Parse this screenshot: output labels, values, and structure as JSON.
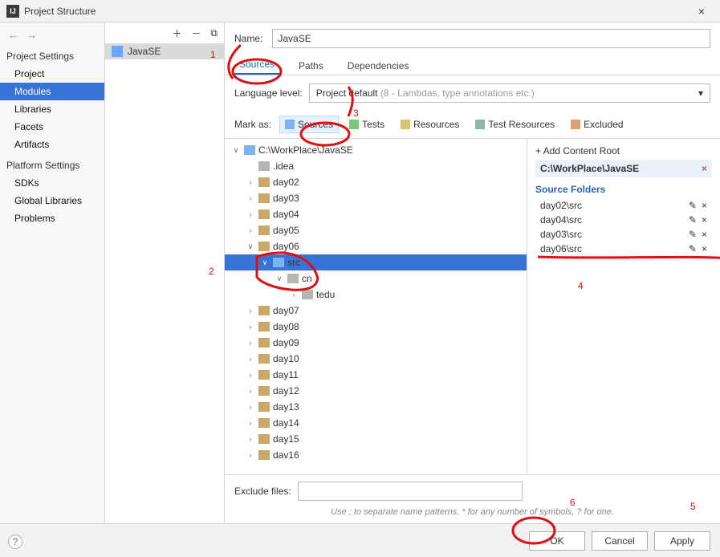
{
  "window": {
    "title": "Project Structure",
    "close": "×",
    "ok": "OK",
    "cancel": "Cancel",
    "apply": "Apply"
  },
  "nav": {
    "sections": [
      {
        "header": "Project Settings",
        "items": [
          "Project",
          "Modules",
          "Libraries",
          "Facets",
          "Artifacts"
        ],
        "selected": 1
      },
      {
        "header": "Platform Settings",
        "items": [
          "SDKs",
          "Global Libraries"
        ]
      },
      {
        "header": "",
        "items": [
          "Problems"
        ]
      }
    ]
  },
  "module": {
    "listItem": "JavaSE",
    "nameLabel": "Name:",
    "name": "JavaSE",
    "tabs": [
      "Sources",
      "Paths",
      "Dependencies"
    ],
    "activeTab": 0,
    "langLabel": "Language level:",
    "langValue": "Project default",
    "langHint": "(8 - Lambdas, type annotations etc.)",
    "markLabel": "Mark as:",
    "markButtons": [
      {
        "label": "Sources",
        "klass": "blue",
        "active": true
      },
      {
        "label": "Tests",
        "klass": "green"
      },
      {
        "label": "Resources",
        "klass": "yellow"
      },
      {
        "label": "Test Resources",
        "klass": "teal"
      },
      {
        "label": "Excluded",
        "klass": "orange"
      }
    ]
  },
  "tree": [
    {
      "depth": 0,
      "arrow": "∨",
      "icon": "mod",
      "label": "C:\\WorkPlace\\JavaSE"
    },
    {
      "depth": 1,
      "arrow": "",
      "icon": "grey",
      "label": ".idea"
    },
    {
      "depth": 1,
      "arrow": "›",
      "icon": "folder",
      "label": "day02"
    },
    {
      "depth": 1,
      "arrow": "›",
      "icon": "folder",
      "label": "day03"
    },
    {
      "depth": 1,
      "arrow": "›",
      "icon": "folder",
      "label": "day04"
    },
    {
      "depth": 1,
      "arrow": "›",
      "icon": "folder",
      "label": "day05"
    },
    {
      "depth": 1,
      "arrow": "∨",
      "icon": "folder",
      "label": "day06"
    },
    {
      "depth": 2,
      "arrow": "∨",
      "icon": "mod",
      "label": "src",
      "selected": true
    },
    {
      "depth": 3,
      "arrow": "∨",
      "icon": "grey",
      "label": "cn"
    },
    {
      "depth": 4,
      "arrow": "›",
      "icon": "grey",
      "label": "tedu"
    },
    {
      "depth": 1,
      "arrow": "›",
      "icon": "folder",
      "label": "day07"
    },
    {
      "depth": 1,
      "arrow": "›",
      "icon": "folder",
      "label": "day08"
    },
    {
      "depth": 1,
      "arrow": "›",
      "icon": "folder",
      "label": "day09"
    },
    {
      "depth": 1,
      "arrow": "›",
      "icon": "folder",
      "label": "day10"
    },
    {
      "depth": 1,
      "arrow": "›",
      "icon": "folder",
      "label": "day11"
    },
    {
      "depth": 1,
      "arrow": "›",
      "icon": "folder",
      "label": "day12"
    },
    {
      "depth": 1,
      "arrow": "›",
      "icon": "folder",
      "label": "day13"
    },
    {
      "depth": 1,
      "arrow": "›",
      "icon": "folder",
      "label": "day14"
    },
    {
      "depth": 1,
      "arrow": "›",
      "icon": "folder",
      "label": "day15"
    },
    {
      "depth": 1,
      "arrow": "›",
      "icon": "folder",
      "label": "dav16"
    }
  ],
  "contentRoot": {
    "addLabel": "+ Add Content Root",
    "path": "C:\\WorkPlace\\JavaSE",
    "sourcesHeader": "Source Folders",
    "sources": [
      "day02\\src",
      "day04\\src",
      "day03\\src",
      "day06\\src"
    ]
  },
  "exclude": {
    "label": "Exclude files:",
    "hint": "Use ; to separate name patterns, * for any number of symbols, ? for one."
  },
  "annotations": {
    "n1": "1",
    "n2": "2",
    "n3": "3",
    "n4": "4",
    "n5": "5",
    "n6": "6"
  }
}
